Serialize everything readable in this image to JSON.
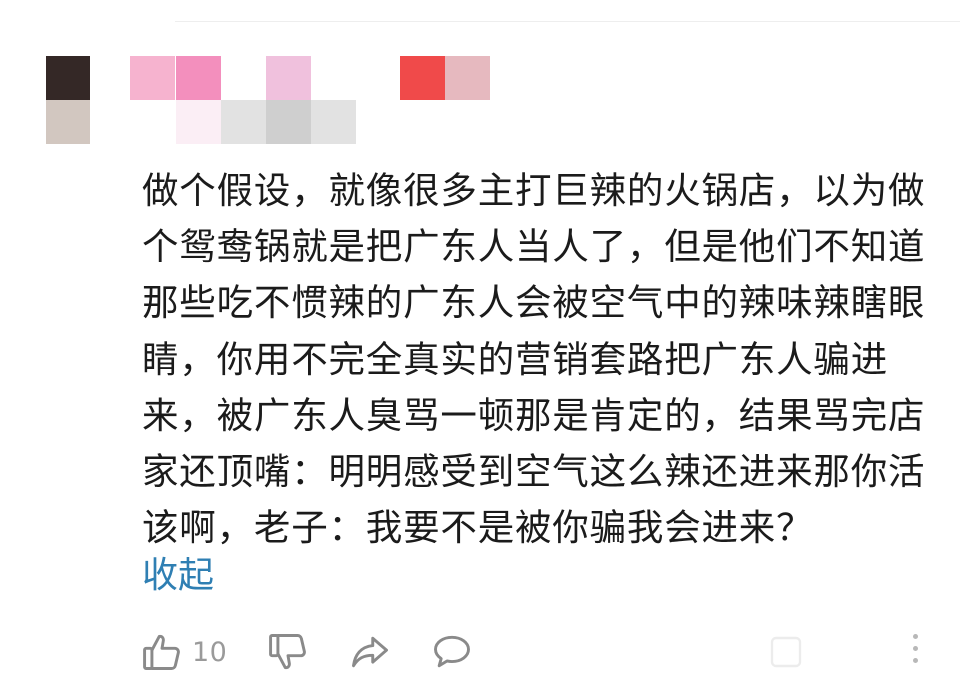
{
  "comment": {
    "lines": [
      "做个假设，就像很多主打巨辣的火锅店，以为做",
      "个鸳鸯锅就是把广东人当人了，但是他们不知道",
      "那些吃不惯辣的广东人会被空气中的辣味辣瞎眼",
      "睛，你用不完全真实的营销套路把广东人骗进",
      "来，被广东人臭骂一顿那是肯定的，结果骂完店",
      "家还顶嘴：明明感受到空气这么辣还进来那你活",
      "该啊，老子：我要不是被你骗我会进来？"
    ],
    "collapse_label": "收起"
  },
  "actions": {
    "like_count": "10",
    "icons": [
      "thumbs-up-icon",
      "thumbs-down-icon",
      "share-icon",
      "comment-icon",
      "more-icon"
    ]
  },
  "colors": {
    "text": "#1b1b1b",
    "link": "#2f7fb3",
    "icon": "#8a8a8a",
    "muted": "#9a9a9a"
  }
}
